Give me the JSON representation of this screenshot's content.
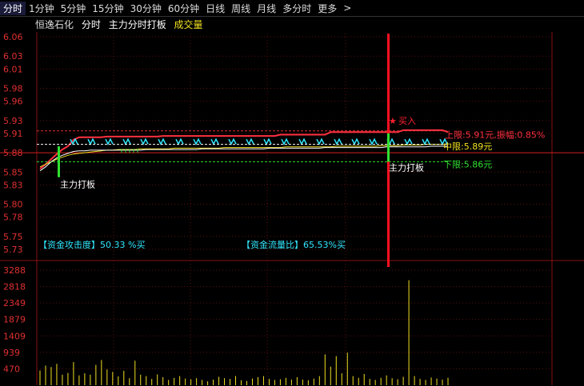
{
  "tabs": [
    "分时",
    "1分钟",
    "5分钟",
    "15分钟",
    "30分钟",
    "60分钟",
    "日线",
    "周线",
    "月线",
    "多分时",
    "更多"
  ],
  "more_chevron": "chevron-right-icon",
  "header": {
    "stock_name": "恒逸石化",
    "view": "分时",
    "indicator": "主力分时打板",
    "volume_label": "成交量"
  },
  "colors": {
    "price_axis": "#e03030",
    "up": "#ff3040",
    "cyan": "#30e8ff",
    "yellow": "#f0e020",
    "green": "#30e030",
    "white": "#ffffff"
  },
  "annotations": {
    "left_signal": "主力打板",
    "right_signal": "主力打板",
    "buy_label": "买入",
    "upper_limit": "上限:5.91元,振幅:0.85%",
    "mid_limit": "中限:5.89元",
    "lower_limit": "下限:5.86元",
    "attack_label": "【资金攻击度】50.33 %买",
    "flow_label": "【资金流量比】65.53%买"
  },
  "chart_data": {
    "type": "line",
    "price_axis": {
      "ticks": [
        "6.06",
        "6.03",
        "6.01",
        "5.98",
        "5.96",
        "5.93",
        "5.91",
        "5.88",
        "5.85",
        "5.83",
        "5.80",
        "5.78",
        "5.75",
        "5.73"
      ],
      "range": [
        5.725,
        6.065
      ],
      "reference": 5.88
    },
    "volume_axis": {
      "ticks": [
        "3288",
        "2818",
        "2349",
        "1879",
        "1409",
        "939",
        "470"
      ],
      "range": [
        0,
        3288
      ]
    },
    "series": [
      {
        "values": [
          5.855,
          5.862,
          5.87,
          5.878,
          5.885,
          5.89,
          5.9,
          5.904,
          5.904,
          5.904,
          5.904,
          5.904,
          5.905,
          5.905,
          5.905,
          5.905,
          5.905,
          5.905,
          5.905,
          5.905,
          5.905,
          5.905,
          5.906,
          5.906,
          5.906,
          5.906,
          5.906,
          5.906,
          5.906,
          5.906,
          5.906,
          5.906,
          5.906,
          5.906,
          5.906,
          5.906,
          5.906,
          5.906,
          5.906,
          5.906,
          5.906,
          5.906,
          5.906,
          5.908,
          5.908,
          5.908,
          5.908,
          5.908,
          5.908,
          5.908,
          5.908,
          5.908,
          5.912,
          5.912,
          5.912,
          5.912,
          5.912,
          5.912,
          5.912,
          5.912,
          5.912,
          5.912,
          5.912,
          5.912,
          5.912,
          5.915,
          5.915,
          5.915,
          5.915,
          5.915,
          5.915,
          5.915,
          5.915,
          5.912
        ]
      },
      {
        "values": [
          5.858,
          5.862,
          5.866,
          5.87,
          5.873,
          5.876,
          5.878,
          5.879,
          5.88,
          5.881,
          5.882,
          5.883,
          5.884,
          5.884,
          5.885,
          5.885,
          5.885,
          5.885,
          5.886,
          5.886,
          5.886,
          5.886,
          5.886,
          5.886,
          5.887,
          5.887,
          5.887,
          5.887,
          5.887,
          5.887,
          5.887,
          5.887,
          5.887,
          5.888,
          5.888,
          5.888,
          5.888,
          5.888,
          5.888,
          5.888,
          5.888,
          5.888,
          5.888,
          5.888,
          5.889,
          5.889,
          5.889,
          5.889,
          5.889,
          5.889,
          5.889,
          5.889,
          5.889,
          5.89,
          5.89,
          5.89,
          5.89,
          5.89,
          5.89,
          5.89,
          5.89,
          5.891,
          5.891,
          5.891,
          5.891,
          5.892,
          5.892,
          5.892,
          5.892,
          5.893,
          5.893,
          5.893,
          5.893,
          5.893
        ]
      },
      {
        "values": [
          5.852,
          5.858,
          5.866,
          5.872,
          5.876,
          5.879,
          5.882,
          5.883,
          5.883,
          5.884,
          5.884,
          5.884,
          5.884,
          5.884,
          5.884,
          5.884,
          5.884,
          5.884,
          5.884,
          5.885,
          5.885,
          5.885,
          5.885,
          5.885,
          5.885,
          5.885,
          5.885,
          5.885,
          5.885,
          5.886,
          5.886,
          5.886,
          5.886,
          5.886,
          5.886,
          5.886,
          5.886,
          5.886,
          5.886,
          5.886,
          5.886,
          5.887,
          5.887,
          5.887,
          5.887,
          5.887,
          5.887,
          5.887,
          5.887,
          5.887,
          5.887,
          5.888,
          5.888,
          5.888,
          5.888,
          5.888,
          5.888,
          5.888,
          5.888,
          5.888,
          5.888,
          5.888,
          5.889,
          5.889,
          5.889,
          5.889,
          5.889,
          5.889,
          5.889,
          5.889,
          5.89,
          5.89,
          5.89,
          5.89
        ]
      }
    ],
    "volume_bars": [
      420,
      560,
      520,
      610,
      300,
      350,
      660,
      280,
      340,
      300,
      580,
      720,
      450,
      380,
      250,
      410,
      200,
      700,
      300,
      260,
      180,
      310,
      230,
      150,
      210,
      260,
      190,
      170,
      200,
      150,
      110,
      160,
      240,
      200,
      180,
      260,
      140,
      120,
      190,
      230,
      260,
      180,
      150,
      170,
      210,
      160,
      230,
      160,
      140,
      190,
      260,
      880,
      530,
      830,
      340,
      930,
      260,
      210,
      320,
      180,
      150,
      210,
      280,
      200,
      170,
      240,
      3000,
      260,
      180,
      150,
      220,
      190,
      160,
      210
    ]
  }
}
